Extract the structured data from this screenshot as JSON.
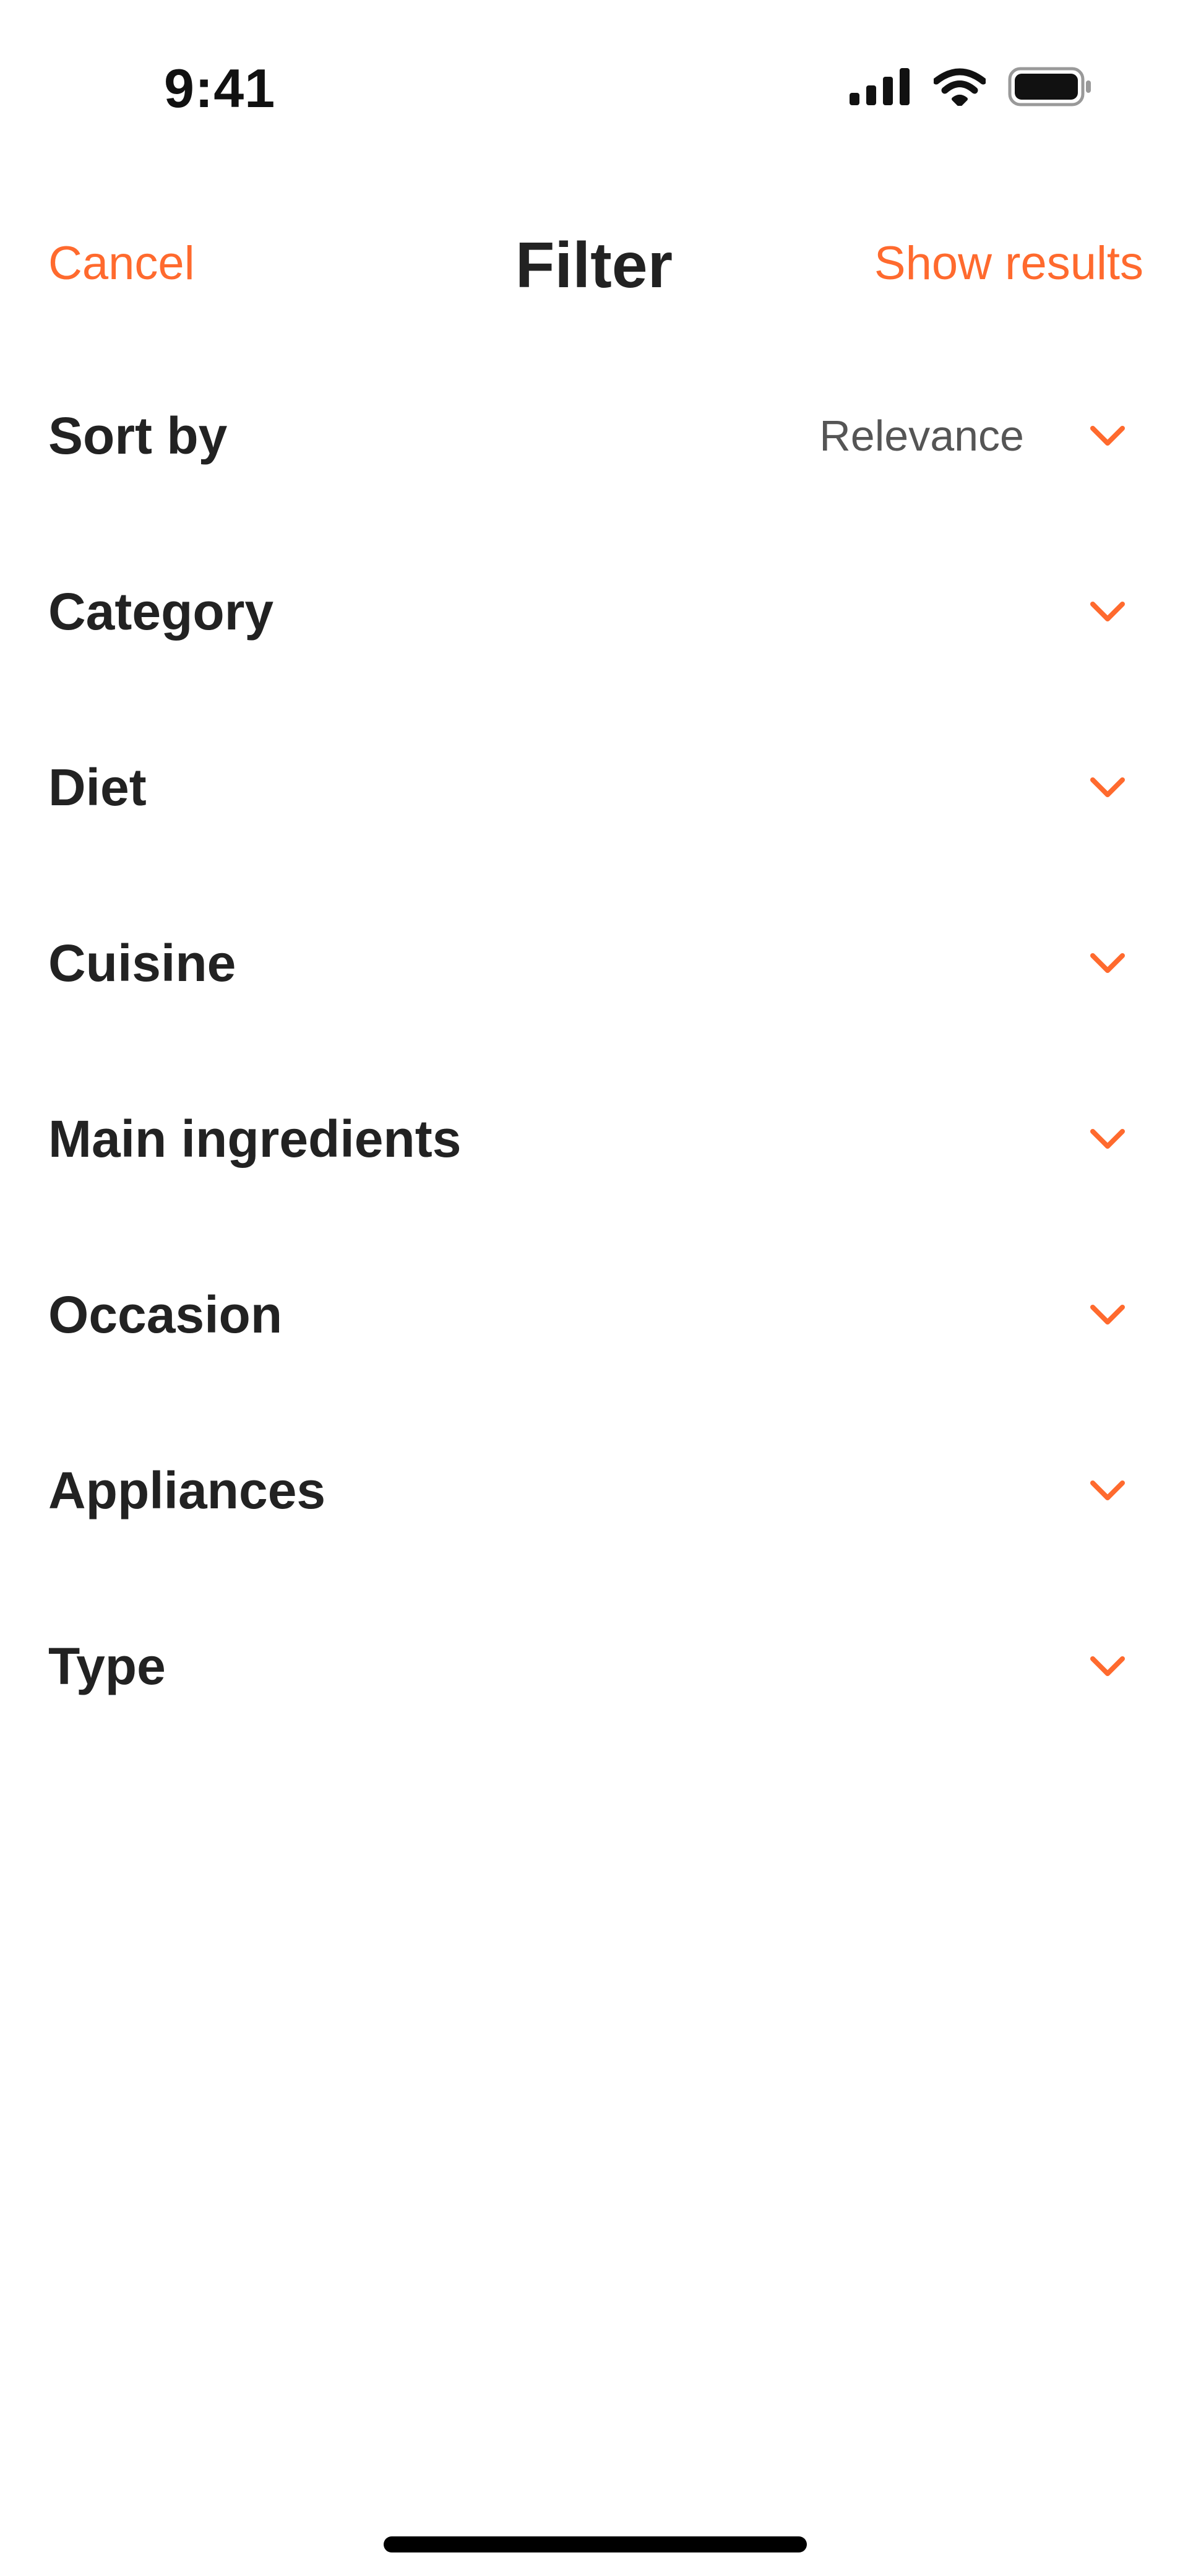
{
  "status_bar": {
    "time": "9:41",
    "icons": [
      "cellular-signal-icon",
      "wifi-icon",
      "battery-icon"
    ]
  },
  "nav": {
    "cancel_label": "Cancel",
    "title": "Filter",
    "show_results_label": "Show results"
  },
  "filters": [
    {
      "label": "Sort by",
      "value": "Relevance"
    },
    {
      "label": "Category",
      "value": ""
    },
    {
      "label": "Diet",
      "value": ""
    },
    {
      "label": "Cuisine",
      "value": ""
    },
    {
      "label": "Main ingredients",
      "value": ""
    },
    {
      "label": "Occasion",
      "value": ""
    },
    {
      "label": "Appliances",
      "value": ""
    },
    {
      "label": "Type",
      "value": ""
    }
  ],
  "colors": {
    "accent": "#ff6a2e",
    "text_primary": "#222222",
    "text_secondary": "#555555",
    "background": "#ffffff"
  },
  "icons": {
    "chevron": "chevron-down-icon"
  }
}
